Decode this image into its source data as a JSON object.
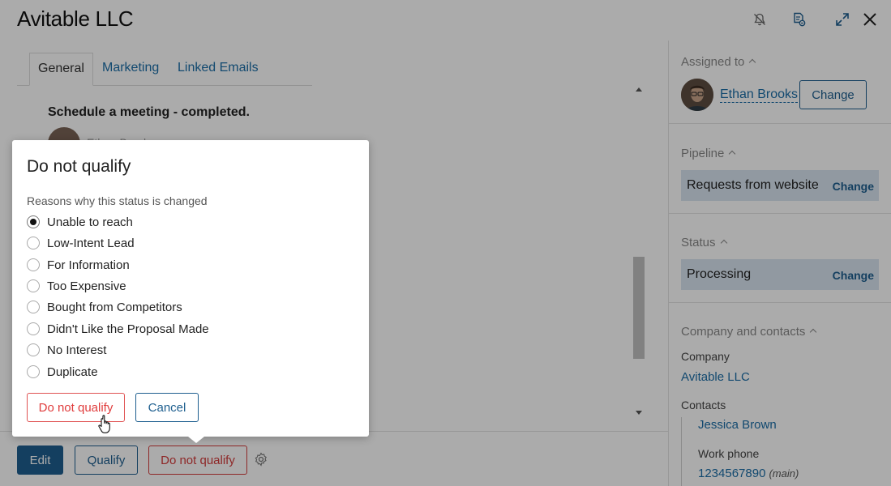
{
  "header": {
    "title": "Avitable LLC",
    "icons": [
      "notifications-off-icon",
      "document-icon",
      "expand-icon",
      "close-icon"
    ]
  },
  "tabs": [
    {
      "label": "General",
      "active": true
    },
    {
      "label": "Marketing",
      "active": false
    },
    {
      "label": "Linked Emails",
      "active": false
    }
  ],
  "activity": {
    "title": "Schedule a meeting - completed.",
    "author": "Ethan Brooks"
  },
  "footer": {
    "edit_label": "Edit",
    "qualify_label": "Qualify",
    "do_not_qualify_label": "Do not qualify"
  },
  "right_panel": {
    "assigned_to": {
      "label": "Assigned to",
      "name": "Ethan Brooks",
      "change_label": "Change"
    },
    "pipeline": {
      "label": "Pipeline",
      "value": "Requests from website",
      "change_label": "Change"
    },
    "status": {
      "label": "Status",
      "value": "Processing",
      "change_label": "Change"
    },
    "company_contacts": {
      "label": "Company and contacts",
      "company_label": "Company",
      "company_name": "Avitable LLC",
      "contacts_label": "Contacts",
      "contact_name": "Jessica Brown",
      "work_phone_label": "Work phone",
      "work_phone": "1234567890",
      "work_phone_tag": "(main)"
    }
  },
  "dialog": {
    "title": "Do not qualify",
    "subtitle": "Reasons why this status is changed",
    "options": [
      {
        "label": "Unable to reach",
        "checked": true
      },
      {
        "label": "Low-Intent Lead",
        "checked": false
      },
      {
        "label": "For Information",
        "checked": false
      },
      {
        "label": "Too Expensive",
        "checked": false
      },
      {
        "label": "Bought from Competitors",
        "checked": false
      },
      {
        "label": "Didn't Like the Proposal Made",
        "checked": false
      },
      {
        "label": "No Interest",
        "checked": false
      },
      {
        "label": "Duplicate",
        "checked": false
      }
    ],
    "confirm_label": "Do not qualify",
    "cancel_label": "Cancel"
  },
  "colors": {
    "accent": "#1e5f8f",
    "link": "#1b6ea7",
    "danger": "#d43c3c",
    "highlight_box": "#d9e5f0"
  }
}
